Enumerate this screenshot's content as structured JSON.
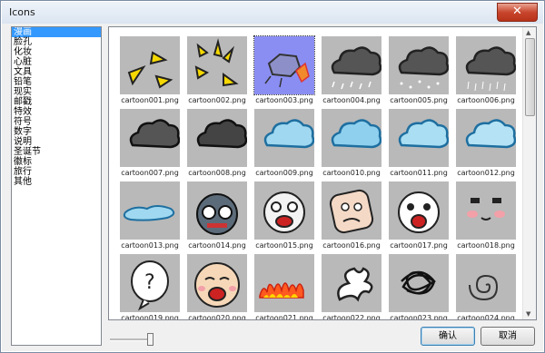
{
  "window": {
    "title": "Icons",
    "close_label": "✕"
  },
  "categories": [
    "漫画",
    "脸孔",
    "化妆",
    "心脏",
    "文具",
    "铅笔",
    "现实",
    "邮戳",
    "特效",
    "符号",
    "数字",
    "说明",
    "圣诞节",
    "徽标",
    "旅行",
    "其他"
  ],
  "selected_category": "漫画",
  "icons": [
    {
      "name": "cartoon001.png",
      "art": "bolts-yellow"
    },
    {
      "name": "cartoon002.png",
      "art": "bolts-burst"
    },
    {
      "name": "cartoon003.png",
      "art": "crash"
    },
    {
      "name": "cartoon004.png",
      "art": "cloud-rain"
    },
    {
      "name": "cartoon005.png",
      "art": "cloud-snow"
    },
    {
      "name": "cartoon006.png",
      "art": "cloud-drizzle"
    },
    {
      "name": "cartoon007.png",
      "art": "cloud-dark"
    },
    {
      "name": "cartoon008.png",
      "art": "cloud-dark2"
    },
    {
      "name": "cartoon009.png",
      "art": "cloud-blue"
    },
    {
      "name": "cartoon010.png",
      "art": "cloud-blue2"
    },
    {
      "name": "cartoon011.png",
      "art": "cloud-blue3"
    },
    {
      "name": "cartoon012.png",
      "art": "cloud-blue4"
    },
    {
      "name": "cartoon013.png",
      "art": "cloud-flat"
    },
    {
      "name": "cartoon014.png",
      "art": "face-robot"
    },
    {
      "name": "cartoon015.png",
      "art": "face-scream"
    },
    {
      "name": "cartoon016.png",
      "art": "face-grump"
    },
    {
      "name": "cartoon017.png",
      "art": "face-shout"
    },
    {
      "name": "cartoon018.png",
      "art": "face-blush"
    },
    {
      "name": "cartoon019.png",
      "art": "bubble-question"
    },
    {
      "name": "cartoon020.png",
      "art": "face-laugh"
    },
    {
      "name": "cartoon021.png",
      "art": "fire"
    },
    {
      "name": "cartoon022.png",
      "art": "splat"
    },
    {
      "name": "cartoon023.png",
      "art": "scribble"
    },
    {
      "name": "cartoon024.png",
      "art": "spiral"
    }
  ],
  "selected_icon": "cartoon003.png",
  "buttons": {
    "ok": "确认",
    "cancel": "取消"
  },
  "colors": {
    "selection": "#3399ff",
    "thumb_bg": "#b9b9b9",
    "thumb_selected_bg": "#8a8ef2"
  }
}
